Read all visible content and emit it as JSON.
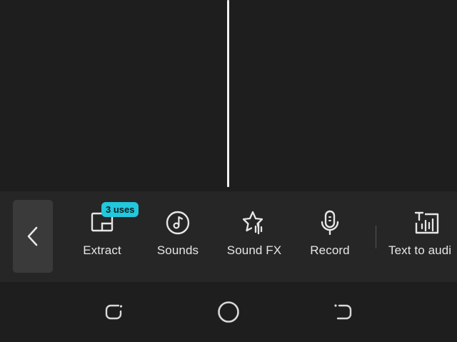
{
  "toolbar": {
    "badge": "3 uses",
    "items": [
      {
        "label": "Extract",
        "icon": "extract-icon"
      },
      {
        "label": "Sounds",
        "icon": "music-note-icon"
      },
      {
        "label": "Sound FX",
        "icon": "star-sound-icon"
      },
      {
        "label": "Record",
        "icon": "microphone-icon"
      },
      {
        "label": "Text to audi",
        "icon": "text-to-audio-icon"
      }
    ]
  },
  "colors": {
    "background": "#1e1e1e",
    "toolbar": "#262626",
    "badge": "#22c8dc",
    "text": "#e6e6e6"
  }
}
